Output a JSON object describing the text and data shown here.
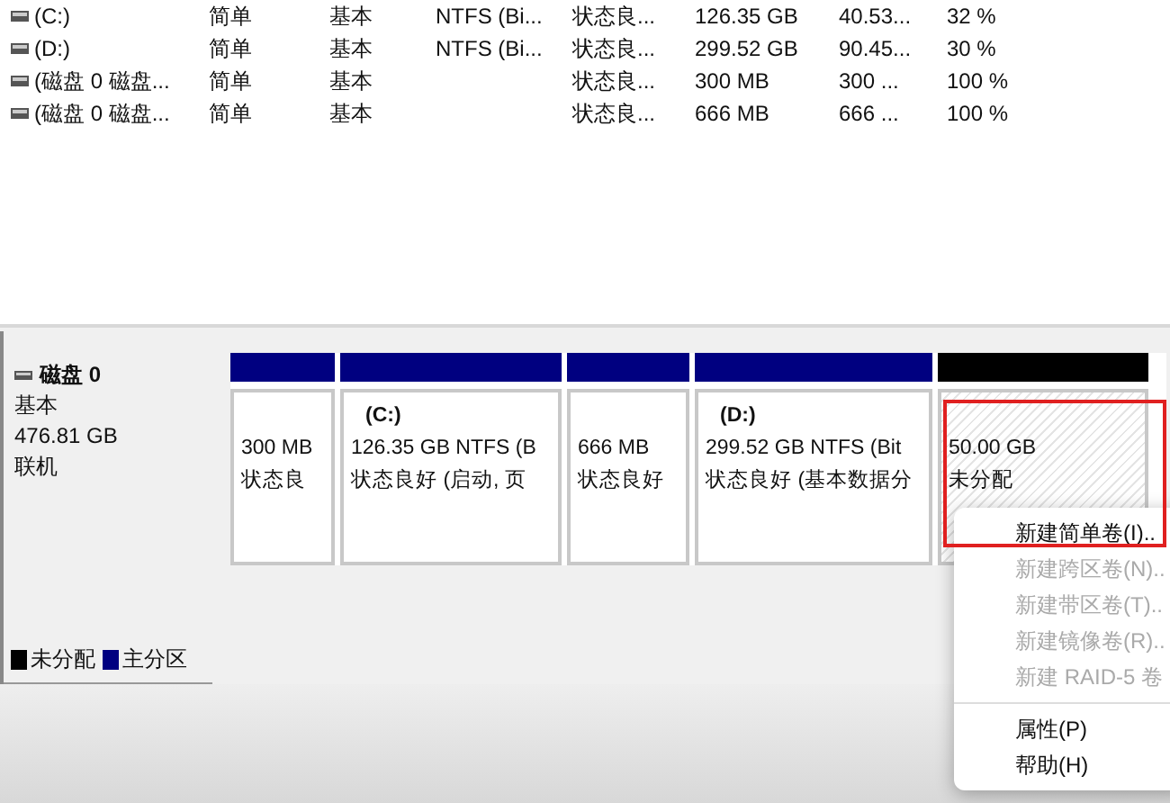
{
  "volumes": [
    {
      "name": "(C:)",
      "layout": "简单",
      "type": "基本",
      "fs": "NTFS (Bi...",
      "status": "状态良...",
      "capacity": "126.35 GB",
      "free": "40.53...",
      "percent": "32 %"
    },
    {
      "name": "(D:)",
      "layout": "简单",
      "type": "基本",
      "fs": "NTFS (Bi...",
      "status": "状态良...",
      "capacity": "299.52 GB",
      "free": "90.45...",
      "percent": "30 %"
    },
    {
      "name": "(磁盘 0 磁盘...",
      "layout": "简单",
      "type": "基本",
      "status": "状态良...",
      "capacity": "300 MB",
      "free": "300 ...",
      "percent": "100 %"
    },
    {
      "name": "(磁盘 0 磁盘...",
      "layout": "简单",
      "type": "基本",
      "status": "状态良...",
      "capacity": "666 MB",
      "free": "666 ...",
      "percent": "100 %"
    }
  ],
  "disk": {
    "name": "磁盘 0",
    "type": "基本",
    "size": "476.81 GB",
    "state": "联机"
  },
  "partitions": [
    {
      "kind": "primary",
      "size": "300 MB",
      "status": "状态良"
    },
    {
      "kind": "primary",
      "label": "(C:)",
      "size": "126.35 GB NTFS (B",
      "status": "状态良好 (启动, 页"
    },
    {
      "kind": "primary",
      "size": "666 MB",
      "status": "状态良好"
    },
    {
      "kind": "primary",
      "label": "(D:)",
      "size": "299.52 GB NTFS (Bit",
      "status": "状态良好 (基本数据分"
    },
    {
      "kind": "unallocated",
      "size": "50.00 GB",
      "status": "未分配"
    }
  ],
  "legend": [
    {
      "label": "未分配",
      "color": "#000000"
    },
    {
      "label": "主分区",
      "color": "#000080"
    }
  ],
  "context_menu": [
    {
      "kind": "item",
      "label": "新建简单卷(I)..",
      "disabled": false
    },
    {
      "kind": "item",
      "label": "新建跨区卷(N)..",
      "disabled": true
    },
    {
      "kind": "item",
      "label": "新建带区卷(T)..",
      "disabled": true
    },
    {
      "kind": "item",
      "label": "新建镜像卷(R)..",
      "disabled": true
    },
    {
      "kind": "item",
      "label": "新建 RAID-5 卷",
      "disabled": true
    },
    {
      "kind": "separator"
    },
    {
      "kind": "item",
      "label": "属性(P)",
      "disabled": false
    },
    {
      "kind": "item",
      "label": "帮助(H)",
      "disabled": false
    }
  ]
}
